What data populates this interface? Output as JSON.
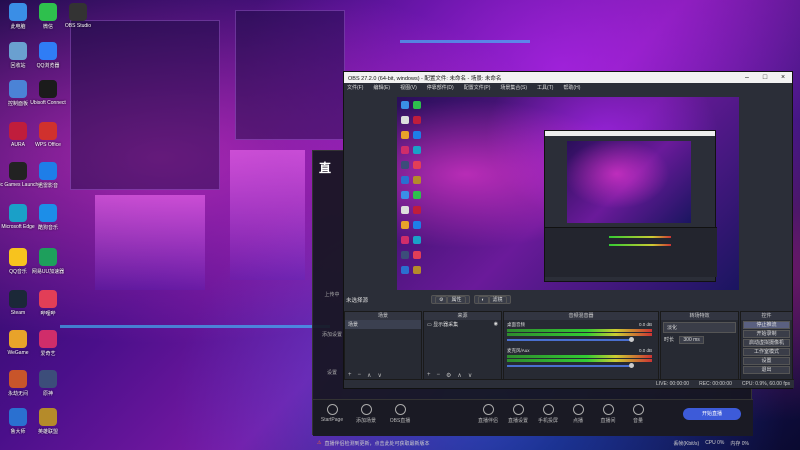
{
  "desktop": {
    "icons": [
      {
        "label": "此电脑",
        "icon": "computer-icon",
        "color": "#3a8ee6"
      },
      {
        "label": "微信",
        "icon": "wechat-icon",
        "color": "#2ec04d"
      },
      {
        "label": "OBS Studio",
        "icon": "obs-icon",
        "color": "#333"
      },
      {
        "label": "回收站",
        "icon": "recycle-bin-icon",
        "color": "#6aa0d0"
      },
      {
        "label": "QQ浏览器",
        "icon": "qq-browser-icon",
        "color": "#2f7df6"
      },
      {
        "label": "控制面板",
        "icon": "control-panel-icon",
        "color": "#4b83d6"
      },
      {
        "label": "Ubisoft Connect",
        "icon": "ubisoft-icon",
        "color": "#1b1b1b"
      },
      {
        "label": "AURA",
        "icon": "aura-icon",
        "color": "#c01d3c"
      },
      {
        "label": "WPS Office",
        "icon": "wps-icon",
        "color": "#d0312d"
      },
      {
        "label": "Epic Games Launcher",
        "icon": "epic-icon",
        "color": "#222"
      },
      {
        "label": "迅雷影音",
        "icon": "player-icon",
        "color": "#1e7ee8"
      },
      {
        "label": "Microsoft Edge",
        "icon": "edge-icon",
        "color": "#1aa0c8"
      },
      {
        "label": "酷狗音乐",
        "icon": "kugou-icon",
        "color": "#1c8ee8"
      },
      {
        "label": "QQ音乐",
        "icon": "qq-music-icon",
        "color": "#f7c31e"
      },
      {
        "label": "网易UU加速器",
        "icon": "uu-icon",
        "color": "#1e9f5c"
      },
      {
        "label": "Steam",
        "icon": "steam-icon",
        "color": "#1b2838"
      },
      {
        "label": "哔哩哔",
        "icon": "bilibili-icon",
        "color": "#e23e57"
      },
      {
        "label": "WeGame",
        "icon": "wegame-icon",
        "color": "#e8a32a"
      },
      {
        "label": "爱奇艺",
        "icon": "iqiyi-icon",
        "color": "#d02d6a"
      },
      {
        "label": "永劫无间",
        "icon": "game-icon",
        "color": "#c8552a"
      },
      {
        "label": "原神",
        "icon": "genshin-icon",
        "color": "#3c4d7a"
      },
      {
        "label": "鲁大师",
        "icon": "ludashi-icon",
        "color": "#2a70d0"
      },
      {
        "label": "英雄联盟",
        "icon": "lol-icon",
        "color": "#b58b2a"
      }
    ]
  },
  "bgapp": {
    "logo": "直",
    "side_items": [
      "上传中",
      "添加设置",
      "设置"
    ],
    "bottom_items": [
      "直播伴侣",
      "直播设置",
      "手机投屏",
      "点播",
      "直播间",
      "音量",
      "设置"
    ],
    "left_bottom": [
      "StartPage",
      "添加场景",
      "OBS直播"
    ],
    "notice": "直播伴侣检测到更新，点击此处可获取最新版本",
    "right_stats": [
      "丢帧(Kbit/s)",
      "CPU 0%",
      "内存 0%"
    ],
    "start_button": "开始直播"
  },
  "obs": {
    "title": "OBS 27.2.0 (64-bit, windows) - 配置文件: 未命名 - 场景: 未命名",
    "menu": [
      "文件(F)",
      "编辑(E)",
      "视图(V)",
      "停靠部件(D)",
      "配置文件(P)",
      "场景集合(S)",
      "工具(T)",
      "帮助(H)"
    ],
    "scene_label": "未选择源",
    "preview_buttons": [
      "属性",
      "滤镜"
    ],
    "docks": {
      "scenes": {
        "title": "场景",
        "items": [
          "场景"
        ]
      },
      "sources": {
        "title": "来源",
        "items": [
          "显示器采集"
        ]
      },
      "mixer": {
        "title": "音频混音器",
        "channels": [
          {
            "name": "桌面音频",
            "db": "0.0 dB"
          },
          {
            "name": "麦克风/Aux",
            "db": "0.0 dB"
          }
        ]
      },
      "transitions": {
        "title": "转场特效",
        "type": "淡化",
        "duration_label": "时长",
        "duration": "300 ms"
      },
      "controls": {
        "title": "控件",
        "buttons": [
          "停止推流",
          "开始录制",
          "启动虚拟摄像机",
          "工作室模式",
          "设置",
          "退出"
        ]
      }
    },
    "status": [
      "LIVE: 00:00:00",
      "REC: 00:00:00",
      "CPU: 0.9%, 60.00 fps"
    ]
  }
}
